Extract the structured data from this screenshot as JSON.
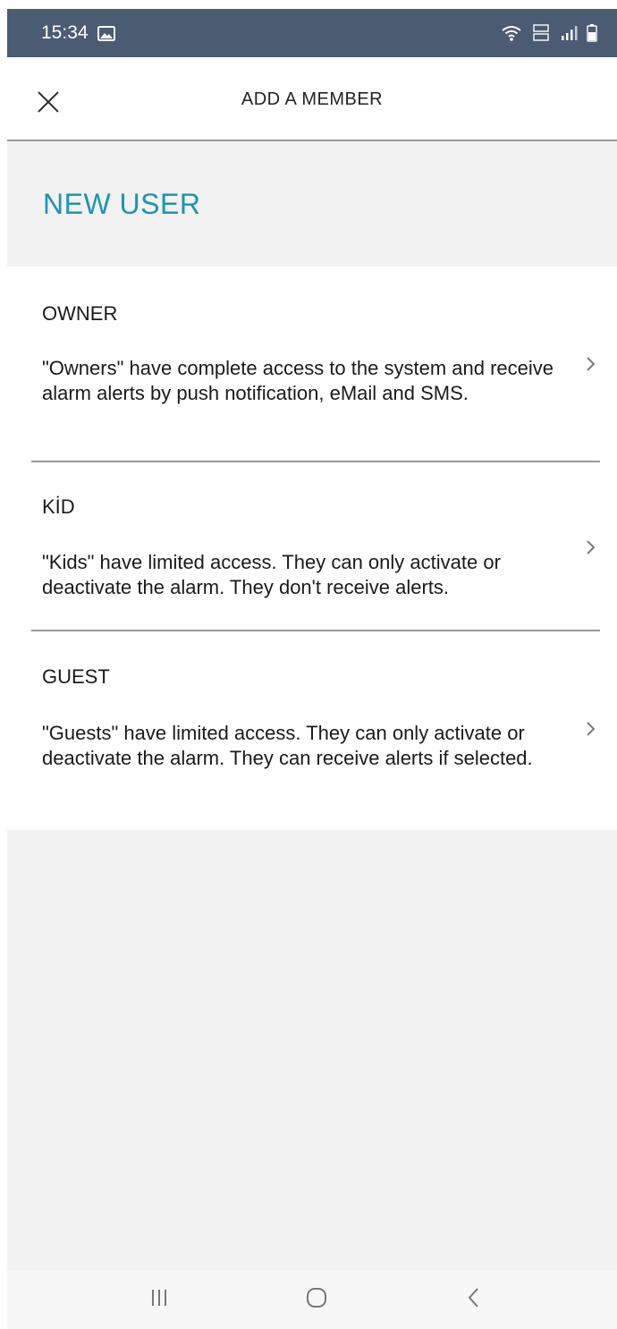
{
  "status_bar": {
    "time": "15:34",
    "icons": [
      "image-notification-icon",
      "wifi-icon",
      "volte-lte-icon",
      "signal-icon",
      "battery-icon"
    ]
  },
  "app_bar": {
    "title": "ADD A MEMBER",
    "close_icon": "close-icon"
  },
  "header": {
    "title": "NEW USER",
    "title_color": "#1c95b0"
  },
  "members": [
    {
      "title": "OWNER",
      "description": "\"Owners\" have complete access to the system and receive alarm alerts by push notification, eMail and SMS."
    },
    {
      "title": "KİD",
      "description": "\"Kids\" have limited access. They can only activate or deactivate the alarm. They don't receive alerts."
    },
    {
      "title": "GUEST",
      "description": "\"Guests\" have limited access. They can only activate or deactivate the alarm. They can receive alerts if selected."
    }
  ],
  "nav_bar": {
    "icons": [
      "recent-apps-icon",
      "home-icon",
      "back-icon"
    ]
  }
}
